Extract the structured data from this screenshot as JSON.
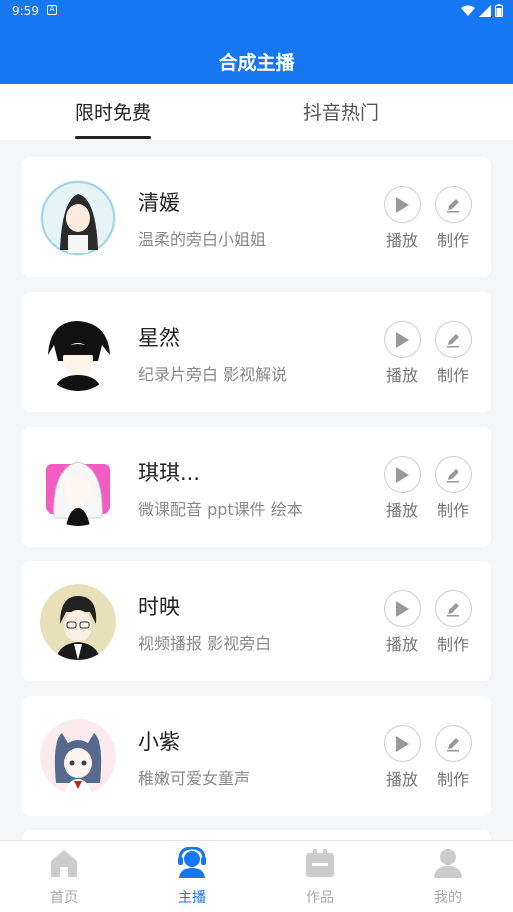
{
  "status": {
    "time": "9:59",
    "notif": "A"
  },
  "appbar": {
    "title": "合成主播"
  },
  "tabs": [
    {
      "label": "限时免费",
      "active": true
    },
    {
      "label": "抖音热门",
      "active": false
    }
  ],
  "anchors": [
    {
      "name": "清媛",
      "desc": "温柔的旁白小姐姐",
      "play": "播放",
      "make": "制作"
    },
    {
      "name": "星然",
      "desc": "纪录片旁白  影视解说",
      "play": "播放",
      "make": "制作"
    },
    {
      "name": "琪琪...",
      "desc": "微课配音 ppt课件 绘本",
      "play": "播放",
      "make": "制作"
    },
    {
      "name": "时映",
      "desc": "视频播报  影视旁白",
      "play": "播放",
      "make": "制作"
    },
    {
      "name": "小紫",
      "desc": "稚嫩可爱女童声",
      "play": "播放",
      "make": "制作"
    }
  ],
  "nav": [
    {
      "label": "首页",
      "icon": "home-icon",
      "active": false
    },
    {
      "label": "主播",
      "icon": "anchor-icon",
      "active": true
    },
    {
      "label": "作品",
      "icon": "works-icon",
      "active": false
    },
    {
      "label": "我的",
      "icon": "profile-icon",
      "active": false
    }
  ],
  "colors": {
    "primary": "#1677f2",
    "inactive": "#cccccc"
  }
}
